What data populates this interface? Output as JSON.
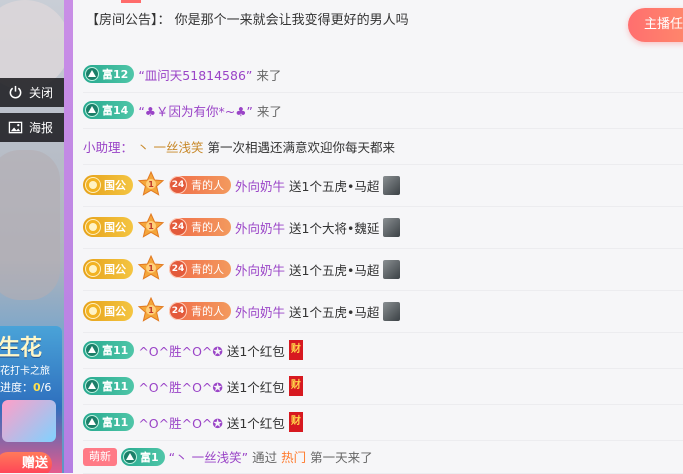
{
  "side_controls": {
    "close_label": "关闭",
    "poster_label": "海报"
  },
  "promo": {
    "title": "生花",
    "line1": "花打卡之旅",
    "progress_prefix": "进度：",
    "progress_value": "0",
    "progress_total": "/6",
    "button": "赠送"
  },
  "notice": {
    "prefix": "【房间公告】：",
    "text": "你是那个一来就会让我变得更好的男人吗"
  },
  "anchor_button": "主播任",
  "rows": [
    {
      "type": "join",
      "level": "富12",
      "nick": "“皿问天51814586”",
      "action": "来了"
    },
    {
      "type": "join",
      "level": "富14",
      "nick": "“♣￥因为有你*~♣”",
      "action": "来了"
    },
    {
      "type": "helper",
      "label": "小助理：",
      "name": "丶 一丝浅笑",
      "text": "第一次相遇还满意欢迎你每天都来"
    },
    {
      "type": "gift",
      "badge": "国公",
      "lv": "24",
      "tag": "青的人",
      "nick": "外向奶牛",
      "text": "送1个五虎•马超"
    },
    {
      "type": "gift",
      "badge": "国公",
      "lv": "24",
      "tag": "青的人",
      "nick": "外向奶牛",
      "text": "送1个大将•魏延"
    },
    {
      "type": "gift",
      "badge": "国公",
      "lv": "24",
      "tag": "青的人",
      "nick": "外向奶牛",
      "text": "送1个五虎•马超"
    },
    {
      "type": "gift",
      "badge": "国公",
      "lv": "24",
      "tag": "青的人",
      "nick": "外向奶牛",
      "text": "送1个五虎•马超"
    },
    {
      "type": "hongbao",
      "level": "富11",
      "nick": "^O^胜^O^✪",
      "text": "送1个红包",
      "icon": "财"
    },
    {
      "type": "hongbao",
      "level": "富11",
      "nick": "^O^胜^O^✪",
      "text": "送1个红包",
      "icon": "财"
    },
    {
      "type": "hongbao",
      "level": "富11",
      "nick": "^O^胜^O^✪",
      "text": "送1个红包",
      "icon": "财"
    },
    {
      "type": "new",
      "tag": "萌新",
      "level": "富1",
      "nick": "“丶 一丝浅笑”",
      "mid": "通过",
      "hot": "热门",
      "tail": "第一天来了"
    }
  ]
}
